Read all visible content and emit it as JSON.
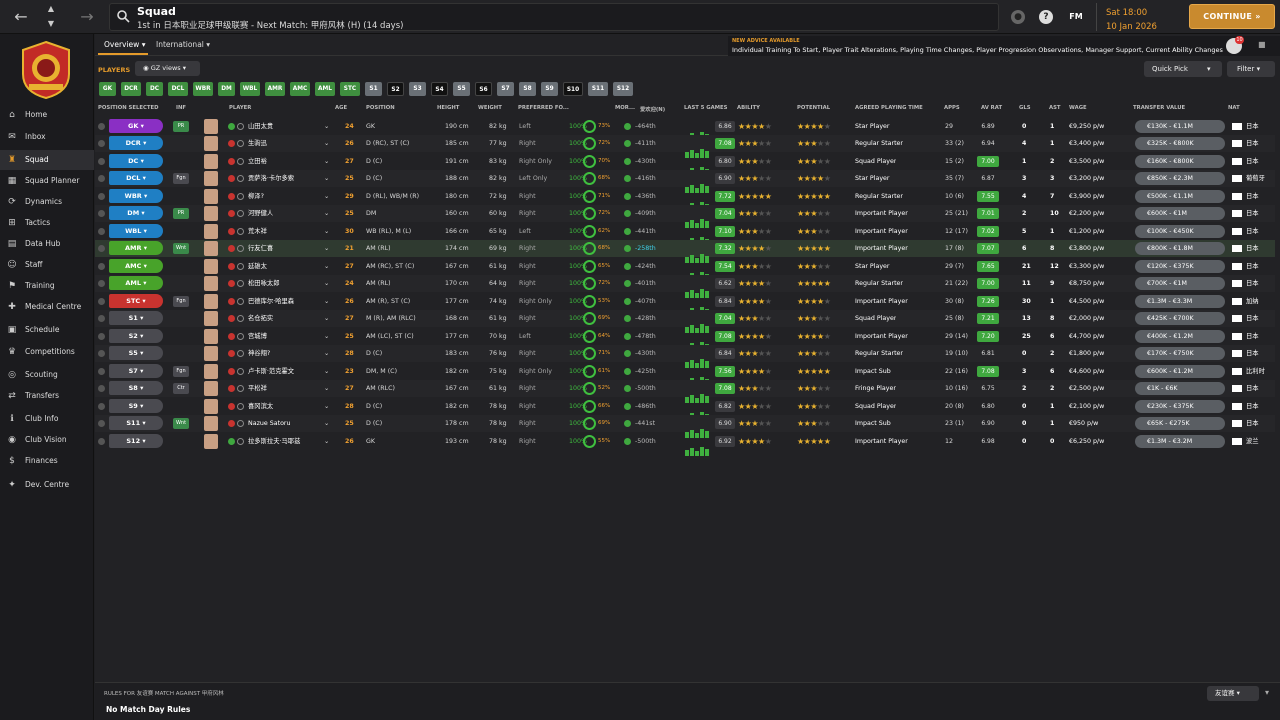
{
  "topbar": {
    "title": "Squad",
    "subtitle": "1st in 日本职业足球甲级联赛 - Next Match: 甲府风林 (H) (14 days)",
    "fm_label": "FM",
    "date_time": "Sat 18:00",
    "date": "10 Jan 2026",
    "continue_label": "CONTINUE"
  },
  "sidebar": {
    "items": [
      {
        "label": "Home",
        "icon": "home-icon"
      },
      {
        "label": "Inbox",
        "icon": "inbox-icon"
      },
      {
        "label": "Squad",
        "icon": "squad-icon",
        "active": true
      },
      {
        "label": "Squad Planner",
        "icon": "planner-icon"
      },
      {
        "label": "Dynamics",
        "icon": "dynamics-icon"
      },
      {
        "label": "Tactics",
        "icon": "tactics-icon"
      },
      {
        "label": "Data Hub",
        "icon": "datahub-icon"
      },
      {
        "label": "Staff",
        "icon": "staff-icon"
      },
      {
        "label": "Training",
        "icon": "training-icon"
      },
      {
        "label": "Medical Centre",
        "icon": "medical-icon"
      },
      {
        "label": "Schedule",
        "icon": "schedule-icon"
      },
      {
        "label": "Competitions",
        "icon": "trophy-icon"
      },
      {
        "label": "Scouting",
        "icon": "scouting-icon"
      },
      {
        "label": "Transfers",
        "icon": "transfers-icon"
      },
      {
        "label": "Club Info",
        "icon": "info-icon"
      },
      {
        "label": "Club Vision",
        "icon": "vision-icon"
      },
      {
        "label": "Finances",
        "icon": "finances-icon"
      },
      {
        "label": "Dev. Centre",
        "icon": "dev-icon"
      }
    ]
  },
  "tabs": {
    "overview": "Overview",
    "international": "International"
  },
  "advice": {
    "title": "NEW ADVICE AVAILABLE",
    "text": "Individual Training To Start, Player Trait Alterations, Playing Time Changes, Player Progression Observations, Manager Support, Current Ability Changes",
    "badge": "10"
  },
  "toolbar": {
    "players_label": "PLAYERS",
    "views_label": "GZ views",
    "quick_pick": "Quick Pick",
    "filter": "Filter"
  },
  "position_filters": [
    {
      "label": "GK",
      "style": "g"
    },
    {
      "label": "DCR",
      "style": "g"
    },
    {
      "label": "DC",
      "style": "g"
    },
    {
      "label": "DCL",
      "style": "g"
    },
    {
      "label": "WBR",
      "style": "g"
    },
    {
      "label": "DM",
      "style": "g"
    },
    {
      "label": "WBL",
      "style": "g"
    },
    {
      "label": "AMR",
      "style": "g"
    },
    {
      "label": "AMC",
      "style": "g"
    },
    {
      "label": "AML",
      "style": "g"
    },
    {
      "label": "STC",
      "style": "g"
    },
    {
      "label": "S1",
      "style": "gr"
    },
    {
      "label": "S2",
      "style": "bk"
    },
    {
      "label": "S3",
      "style": "gr"
    },
    {
      "label": "S4",
      "style": "bk"
    },
    {
      "label": "S5",
      "style": "gr"
    },
    {
      "label": "S6",
      "style": "bk"
    },
    {
      "label": "S7",
      "style": "gr"
    },
    {
      "label": "S8",
      "style": "gr"
    },
    {
      "label": "S9",
      "style": "gr"
    },
    {
      "label": "S10",
      "style": "bk"
    },
    {
      "label": "S11",
      "style": "gr"
    },
    {
      "label": "S12",
      "style": "gr"
    }
  ],
  "columns": {
    "pos_sel": "POSITION SELECTED",
    "inf": "INF",
    "player": "PLAYER",
    "age": "AGE",
    "position": "POSITION",
    "height": "HEIGHT",
    "weight": "WEIGHT",
    "foot": "PREFERRED FO...",
    "mor": "MOR...",
    "pop": "爱欢迎(N)",
    "last5": "LAST 5 GAMES",
    "ability": "ABILITY",
    "potential": "POTENTIAL",
    "playing_time": "AGREED PLAYING TIME",
    "apps": "APPS",
    "av_rat": "AV RAT",
    "gls": "GLS",
    "ast": "AST",
    "wage": "WAGE",
    "tv": "TRANSFER VALUE",
    "nat": "NAT"
  },
  "players": [
    {
      "sel": "GK",
      "type": "gk",
      "inf": "PR",
      "inf_color": "#3a8a4a",
      "name": "山田太贵",
      "age": "24",
      "position": "GK",
      "height": "190 cm",
      "weight": "82 kg",
      "foot": "Left",
      "cond": "100%",
      "sharp": "73%",
      "rank": "-464th",
      "form": "6.86",
      "form_good": false,
      "ability": 3.5,
      "potential": 4,
      "pt": "Star Player",
      "apps": "29",
      "avr": "6.89",
      "avr_good": false,
      "gls": "0",
      "ast": "1",
      "wage": "€9,250 p/w",
      "tv": "€130K - €1.1M",
      "nat": "日本"
    },
    {
      "sel": "DCR",
      "type": "def",
      "inf": "",
      "name": "生驹迅",
      "age": "26",
      "position": "D (RC), ST (C)",
      "height": "185 cm",
      "weight": "77 kg",
      "foot": "Right",
      "cond": "100%",
      "sharp": "72%",
      "rank": "-411th",
      "form": "7.08",
      "form_good": true,
      "ability": 2.5,
      "potential": 2.5,
      "pt": "Regular Starter",
      "apps": "33 (2)",
      "avr": "6.94",
      "avr_good": false,
      "gls": "4",
      "ast": "1",
      "wage": "€3,400 p/w",
      "tv": "€325K - €800K",
      "nat": "日本"
    },
    {
      "sel": "DC",
      "type": "def",
      "inf": "",
      "name": "立田裕",
      "age": "27",
      "position": "D (C)",
      "height": "191 cm",
      "weight": "83 kg",
      "foot": "Right Only",
      "cond": "100%",
      "sharp": "70%",
      "rank": "-430th",
      "form": "6.80",
      "form_good": false,
      "ability": 2.5,
      "potential": 2.5,
      "pt": "Squad Player",
      "apps": "15 (2)",
      "avr": "7.00",
      "avr_good": true,
      "gls": "1",
      "ast": "2",
      "wage": "€3,500 p/w",
      "tv": "€160K - €800K",
      "nat": "日本"
    },
    {
      "sel": "DCL",
      "type": "def",
      "inf": "Fgn",
      "inf_color": "#4a4a50",
      "name": "贡萨洛·卡尔多索",
      "age": "25",
      "position": "D (C)",
      "height": "188 cm",
      "weight": "82 kg",
      "foot": "Left Only",
      "cond": "100%",
      "sharp": "68%",
      "rank": "-416th",
      "form": "6.90",
      "form_good": false,
      "ability": 3,
      "potential": 3.5,
      "pt": "Star Player",
      "apps": "35 (7)",
      "avr": "6.87",
      "avr_good": false,
      "gls": "3",
      "ast": "3",
      "wage": "€3,200 p/w",
      "tv": "€850K - €2.3M",
      "nat": "葡萄牙"
    },
    {
      "sel": "WBR",
      "type": "def",
      "inf": "",
      "name": "柳泽?",
      "age": "29",
      "position": "D (RL), WB/M (R)",
      "height": "180 cm",
      "weight": "72 kg",
      "foot": "Right",
      "cond": "100%",
      "sharp": "71%",
      "rank": "-436th",
      "form": "7.72",
      "form_good": true,
      "ability": 4.5,
      "potential": 4.5,
      "pt": "Regular Starter",
      "apps": "10 (6)",
      "avr": "7.55",
      "avr_good": true,
      "gls": "4",
      "ast": "7",
      "wage": "€3,900 p/w",
      "tv": "€500K - €1.1M",
      "nat": "日本"
    },
    {
      "sel": "DM",
      "type": "def",
      "inf": "PR",
      "inf_color": "#3a8a4a",
      "name": "河野健人",
      "age": "25",
      "position": "DM",
      "height": "160 cm",
      "weight": "60 kg",
      "foot": "Right",
      "cond": "100%",
      "sharp": "72%",
      "rank": "-409th",
      "form": "7.04",
      "form_good": true,
      "ability": 3,
      "potential": 3,
      "pt": "Important Player",
      "apps": "25 (21)",
      "avr": "7.01",
      "avr_good": true,
      "gls": "2",
      "ast": "10",
      "wage": "€2,200 p/w",
      "tv": "€600K - €1M",
      "nat": "日本"
    },
    {
      "sel": "WBL",
      "type": "def",
      "inf": "",
      "name": "荒木祥",
      "age": "30",
      "position": "WB (RL), M (L)",
      "height": "166 cm",
      "weight": "65 kg",
      "foot": "Left",
      "cond": "100%",
      "sharp": "62%",
      "rank": "-441th",
      "form": "7.10",
      "form_good": true,
      "ability": 3,
      "potential": 3,
      "pt": "Important Player",
      "apps": "12 (17)",
      "avr": "7.02",
      "avr_good": true,
      "gls": "5",
      "ast": "1",
      "wage": "€1,200 p/w",
      "tv": "€100K - €450K",
      "nat": "日本"
    },
    {
      "sel": "AMR",
      "type": "am",
      "inf": "Wnt",
      "inf_color": "#3a8a4a",
      "name": "行友仁喜",
      "age": "21",
      "position": "AM (RL)",
      "height": "174 cm",
      "weight": "69 kg",
      "foot": "Right",
      "cond": "100%",
      "sharp": "68%",
      "rank": "-258th",
      "form": "7.32",
      "form_good": true,
      "ability": 4,
      "potential": 5,
      "pt": "Important Player",
      "apps": "17 (8)",
      "avr": "7.07",
      "avr_good": true,
      "gls": "6",
      "ast": "8",
      "wage": "€3,800 p/w",
      "tv": "€800K - €1.8M",
      "nat": "日本",
      "highlight": true
    },
    {
      "sel": "AMC",
      "type": "am",
      "inf": "",
      "name": "延雄太",
      "age": "27",
      "position": "AM (RC), ST (C)",
      "height": "167 cm",
      "weight": "61 kg",
      "foot": "Right",
      "cond": "100%",
      "sharp": "65%",
      "rank": "-424th",
      "form": "7.54",
      "form_good": true,
      "ability": 3,
      "potential": 3,
      "pt": "Star Player",
      "apps": "29 (7)",
      "avr": "7.65",
      "avr_good": true,
      "gls": "21",
      "ast": "12",
      "wage": "€3,300 p/w",
      "tv": "€120K - €375K",
      "nat": "日本"
    },
    {
      "sel": "AML",
      "type": "am",
      "inf": "",
      "name": "松田咏太郎",
      "age": "24",
      "position": "AM (RL)",
      "height": "170 cm",
      "weight": "64 kg",
      "foot": "Right",
      "cond": "100%",
      "sharp": "72%",
      "rank": "-401th",
      "form": "6.62",
      "form_good": false,
      "ability": 4,
      "potential": 4.5,
      "pt": "Regular Starter",
      "apps": "21 (22)",
      "avr": "7.00",
      "avr_good": true,
      "gls": "11",
      "ast": "9",
      "wage": "€8,750 p/w",
      "tv": "€700K - €1M",
      "nat": "日本"
    },
    {
      "sel": "STC",
      "type": "st",
      "inf": "Fgn",
      "inf_color": "#4a4a50",
      "name": "巴德库尔·哈里森",
      "age": "26",
      "position": "AM (R), ST (C)",
      "height": "177 cm",
      "weight": "74 kg",
      "foot": "Right Only",
      "cond": "100%",
      "sharp": "53%",
      "rank": "-407th",
      "form": "6.84",
      "form_good": false,
      "ability": 3.5,
      "potential": 4,
      "pt": "Important Player",
      "apps": "30 (8)",
      "avr": "7.26",
      "avr_good": true,
      "gls": "30",
      "ast": "1",
      "wage": "€4,500 p/w",
      "tv": "€1.3M - €3.3M",
      "nat": "加纳"
    },
    {
      "sel": "S1",
      "type": "sub",
      "inf": "",
      "name": "名仓拓实",
      "age": "27",
      "position": "M (R), AM (RLC)",
      "height": "168 cm",
      "weight": "61 kg",
      "foot": "Right",
      "cond": "100%",
      "sharp": "69%",
      "rank": "-428th",
      "form": "7.04",
      "form_good": true,
      "ability": 3,
      "potential": 3,
      "pt": "Squad Player",
      "apps": "25 (8)",
      "avr": "7.21",
      "avr_good": true,
      "gls": "13",
      "ast": "8",
      "wage": "€2,000 p/w",
      "tv": "€425K - €700K",
      "nat": "日本"
    },
    {
      "sel": "S2",
      "type": "sub",
      "inf": "",
      "name": "宫城博",
      "age": "25",
      "position": "AM (LC), ST (C)",
      "height": "177 cm",
      "weight": "70 kg",
      "foot": "Left",
      "cond": "100%",
      "sharp": "64%",
      "rank": "-478th",
      "form": "7.08",
      "form_good": true,
      "ability": 3.5,
      "potential": 3.5,
      "pt": "Important Player",
      "apps": "29 (14)",
      "avr": "7.20",
      "avr_good": true,
      "gls": "25",
      "ast": "6",
      "wage": "€4,700 p/w",
      "tv": "€400K - €1.2M",
      "nat": "日本"
    },
    {
      "sel": "S5",
      "type": "sub",
      "inf": "",
      "name": "神谷翔?",
      "age": "28",
      "position": "D (C)",
      "height": "183 cm",
      "weight": "76 kg",
      "foot": "Right",
      "cond": "100%",
      "sharp": "71%",
      "rank": "-430th",
      "form": "6.84",
      "form_good": false,
      "ability": 3,
      "potential": 3,
      "pt": "Regular Starter",
      "apps": "19 (10)",
      "avr": "6.81",
      "avr_good": false,
      "gls": "0",
      "ast": "2",
      "wage": "€1,800 p/w",
      "tv": "€170K - €750K",
      "nat": "日本"
    },
    {
      "sel": "S7",
      "type": "sub",
      "inf": "Fgn",
      "inf_color": "#4a4a50",
      "name": "卢卡斯·范克霍文",
      "age": "23",
      "position": "DM, M (C)",
      "height": "182 cm",
      "weight": "75 kg",
      "foot": "Right Only",
      "cond": "100%",
      "sharp": "61%",
      "rank": "-425th",
      "form": "7.56",
      "form_good": true,
      "ability": 3.5,
      "potential": 4.5,
      "pt": "Impact Sub",
      "apps": "22 (16)",
      "avr": "7.08",
      "avr_good": true,
      "gls": "3",
      "ast": "6",
      "wage": "€4,600 p/w",
      "tv": "€600K - €1.2M",
      "nat": "比利时"
    },
    {
      "sel": "S8",
      "type": "sub",
      "inf": "Ctr",
      "inf_color": "#4a4a50",
      "name": "平松祥",
      "age": "27",
      "position": "AM (RLC)",
      "height": "167 cm",
      "weight": "61 kg",
      "foot": "Right",
      "cond": "100%",
      "sharp": "52%",
      "rank": "-500th",
      "form": "7.08",
      "form_good": true,
      "ability": 2.5,
      "potential": 2.5,
      "pt": "Fringe Player",
      "apps": "10 (16)",
      "avr": "6.75",
      "avr_good": false,
      "gls": "2",
      "ast": "2",
      "wage": "€2,500 p/w",
      "tv": "€1K - €6K",
      "nat": "日本"
    },
    {
      "sel": "S9",
      "type": "sub",
      "inf": "",
      "name": "喜冈滨太",
      "age": "28",
      "position": "D (C)",
      "height": "182 cm",
      "weight": "78 kg",
      "foot": "Right",
      "cond": "100%",
      "sharp": "66%",
      "rank": "-486th",
      "form": "6.82",
      "form_good": false,
      "ability": 3,
      "potential": 3,
      "pt": "Squad Player",
      "apps": "20 (8)",
      "avr": "6.80",
      "avr_good": false,
      "gls": "0",
      "ast": "1",
      "wage": "€2,100 p/w",
      "tv": "€230K - €375K",
      "nat": "日本"
    },
    {
      "sel": "S11",
      "type": "sub",
      "inf": "Wnt",
      "inf_color": "#3a8a4a",
      "name": "Nazue Satoru",
      "age": "25",
      "position": "D (C)",
      "height": "178 cm",
      "weight": "78 kg",
      "foot": "Right",
      "cond": "100%",
      "sharp": "69%",
      "rank": "-441st",
      "form": "6.90",
      "form_good": false,
      "ability": 3,
      "potential": 3,
      "pt": "Impact Sub",
      "apps": "23 (1)",
      "avr": "6.90",
      "avr_good": false,
      "gls": "0",
      "ast": "1",
      "wage": "€950 p/w",
      "tv": "€65K - €275K",
      "nat": "日本"
    },
    {
      "sel": "S12",
      "type": "sub",
      "inf": "",
      "name": "拉多斯拉夫·马耶兹",
      "age": "26",
      "position": "GK",
      "height": "193 cm",
      "weight": "78 kg",
      "foot": "Right",
      "cond": "100%",
      "sharp": "55%",
      "rank": "-500th",
      "form": "6.92",
      "form_good": false,
      "ability": 3.5,
      "potential": 4.5,
      "pt": "Important Player",
      "apps": "12",
      "avr": "6.98",
      "avr_good": false,
      "gls": "0",
      "ast": "0",
      "wage": "€6,250 p/w",
      "tv": "€1.3M - €3.2M",
      "nat": "波兰"
    }
  ],
  "footer": {
    "rules_title": "RULES FOR 友谊赛 MATCH AGAINST 甲府风林",
    "rules": "No Match Day Rules",
    "dropdown": "友谊赛"
  }
}
